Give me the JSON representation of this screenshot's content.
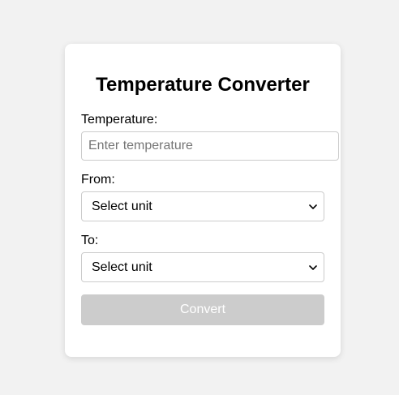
{
  "form": {
    "title": "Temperature Converter",
    "temperature_label": "Temperature:",
    "temperature_placeholder": "Enter temperature",
    "temperature_value": "",
    "from_label": "From:",
    "from_selected": "Select unit",
    "to_label": "To:",
    "to_selected": "Select unit",
    "convert_label": "Convert",
    "convert_disabled": true
  },
  "colors": {
    "background": "#f2f2f2",
    "card": "#ffffff",
    "button_disabled": "#cccccc",
    "border": "#cccccc"
  }
}
